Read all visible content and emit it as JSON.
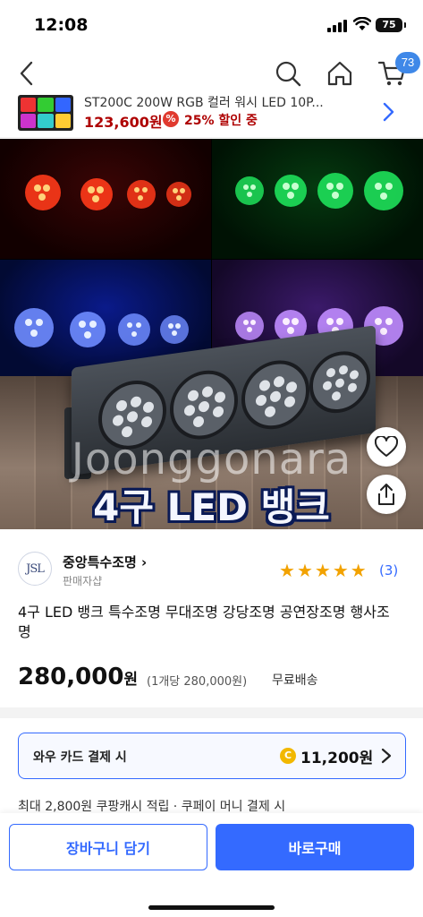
{
  "status_bar": {
    "time": "12:08",
    "battery": "75"
  },
  "nav": {
    "back_icon": "chevron-left-icon",
    "search_icon": "search-icon",
    "home_icon": "home-icon",
    "cart_icon": "cart-icon",
    "cart_count": "73"
  },
  "recommended": {
    "title": "ST200C 200W RGB 컬러 워시 LED 10P...",
    "price": "123,600원",
    "discount": "25% 할인 중"
  },
  "hero": {
    "watermark": "Joonggonara",
    "caption": "4구 LED 뱅크",
    "panel_colors": [
      "#ff2a1a",
      "#1ee05a",
      "#3c62ff",
      "#a65cff"
    ]
  },
  "seller": {
    "logo_text": "JSL",
    "name": "중앙특수조명",
    "sub": "판매자샵",
    "rating_stars": 5,
    "review_count": "(3)"
  },
  "product": {
    "title": "4구 LED 뱅크 특수조명 무대조명 강당조명 공연장조명 행사조명",
    "price": "280,000",
    "price_unit": "원",
    "unit_price": "(1개당 280,000원)",
    "shipping": "무료배송"
  },
  "card_offer": {
    "label": "와우 카드 결제 시",
    "amount": "11,200원"
  },
  "cash_note": "최대 2,800원 쿠팡캐시 적립 · 쿠페이 머니 결제 시",
  "actions": {
    "cart": "장바구니 담기",
    "buy": "바로구매"
  },
  "colors": {
    "accent": "#346aff",
    "price_red": "#ae0000",
    "star": "#f2a200"
  }
}
